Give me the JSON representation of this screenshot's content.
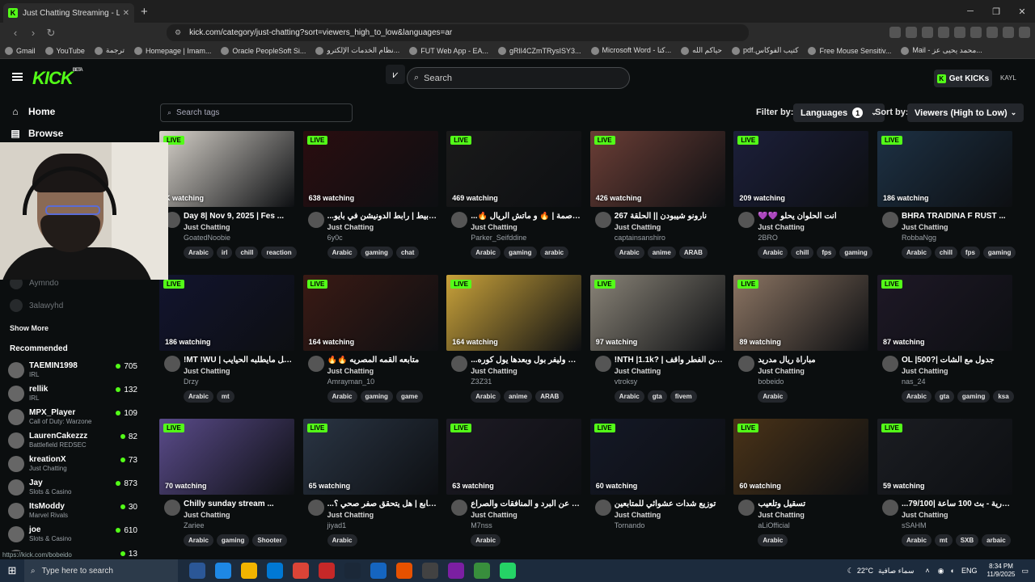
{
  "browser": {
    "tab_title": "Just Chatting Streaming - Live S",
    "tab_close": "✕",
    "new_tab": "+",
    "url": "kick.com/category/just-chatting?sort=viewers_high_to_low&languages=ar",
    "bookmarks": [
      "Gmail",
      "YouTube",
      "ترجمة",
      "Homepage | Imam...",
      "Oracle PeopleSoft Si...",
      "نظام الخدمات الإلكترو...",
      "FUT Web App - EA...",
      "gRlI4CZmTRysISY3...",
      "Microsoft Word - كتا...",
      "حياكم الله",
      "pdf.كتيب الفوكاس",
      "Free Mouse Sensitiv...",
      "Mail - محمد يحيى عز..."
    ]
  },
  "header": {
    "logo": "KICK",
    "beta": "BETA",
    "search_placeholder": "Search",
    "get_kicks": "Get KICKs",
    "user": "KAYL"
  },
  "sidebar": {
    "home": "Home",
    "browse": "Browse",
    "followed": [
      "Aymndo",
      "3alawyhd"
    ],
    "show_more": "Show More",
    "recommended_title": "Recommended",
    "recommended": [
      {
        "name": "TAEMIN1998",
        "cat": "IRL",
        "count": "705"
      },
      {
        "name": "rellik",
        "cat": "IRL",
        "count": "132"
      },
      {
        "name": "MPX_Player",
        "cat": "Call of Duty: Warzone",
        "count": "109"
      },
      {
        "name": "LaurenCakezzz",
        "cat": "Battlefield REDSEC",
        "count": "82"
      },
      {
        "name": "kreationX",
        "cat": "Just Chatting",
        "count": "73"
      },
      {
        "name": "Jay",
        "cat": "Slots & Casino",
        "count": "873"
      },
      {
        "name": "ItsModdy",
        "cat": "Marvel Rivals",
        "count": "30"
      },
      {
        "name": "joe",
        "cat": "Slots & Casino",
        "count": "610"
      },
      {
        "name": "",
        "cat": "",
        "count": "13"
      }
    ],
    "status_url": "https://kick.com/bobeido"
  },
  "filters": {
    "tag_placeholder": "Search tags",
    "filter_by": "Filter by:",
    "languages": "Languages",
    "lang_count": "1",
    "sort_by": "Sort by:",
    "sort_value": "Viewers (High to Low)"
  },
  "streams": [
    {
      "watching": "K watching",
      "title": "Day 8| Nov 9, 2025 | Fes ...",
      "cat": "Just Chatting",
      "user": "GoatedNoobie",
      "tags": [
        "Arabic",
        "irl",
        "chill",
        "reaction"
      ],
      "color": "#d9d4cc"
    },
    {
      "watching": "638 watching",
      "title": "...كم وخرابيط | رابط الدونيشن في بايو",
      "cat": "Just Chatting",
      "user": "6y0c",
      "tags": [
        "Arabic",
        "gaming",
        "chat"
      ],
      "color": "#2a0d10"
    },
    {
      "watching": "469 watching",
      "title": "...🔥 ربي العاصمة | 🔥 و ماتش الريال",
      "cat": "Just Chatting",
      "user": "Parker_Seifddine",
      "tags": [
        "Arabic",
        "gaming",
        "arabic"
      ],
      "color": "#1a1a1a"
    },
    {
      "watching": "426 watching",
      "title": "267 نارونو شيبودن || الحلقة",
      "cat": "Just Chatting",
      "user": "captainsanshiro",
      "tags": [
        "Arabic",
        "anime",
        "ARAB"
      ],
      "color": "#6b3e36"
    },
    {
      "watching": "209 watching",
      "title": "💜💜 انت الحلوان يحلو",
      "cat": "Just Chatting",
      "user": "2BRO",
      "tags": [
        "Arabic",
        "chill",
        "fps",
        "gaming"
      ],
      "color": "#1c1f3a"
    },
    {
      "watching": "186 watching",
      "title": "BHRA TRAIDINA F RUST ...",
      "cat": "Just Chatting",
      "user": "RobbaNgg",
      "tags": [
        "Arabic",
        "chill",
        "fps",
        "gaming"
      ],
      "color": "#1d3144"
    },
    {
      "watching": "186 watching",
      "title": "!MT !WU | وكل مايطلبه الحيايب ...",
      "cat": "Just Chatting",
      "user": "Drzy",
      "tags": [
        "Arabic",
        "mt"
      ],
      "color": "#12142e"
    },
    {
      "watching": "164 watching",
      "title": "🔥🔥 متابعه القمه المصريه",
      "cat": "Just Chatting",
      "user": "Amrayman_10",
      "tags": [
        "Arabic",
        "gaming",
        "game"
      ],
      "color": "#3a1a14"
    },
    {
      "watching": "164 watching",
      "title": "...مبارة الستي وليفر بول وبعدها يول كوره",
      "cat": "Just Chatting",
      "user": "Z3Z31",
      "tags": [
        "Arabic",
        "anime",
        "ARAB"
      ],
      "color": "#c9a23a"
    },
    {
      "watching": "97 watching",
      "title": "!NTH |1.1k? | ديد عن الفطر واقف",
      "cat": "Just Chatting",
      "user": "vtroksy",
      "tags": [
        "Arabic",
        "gta",
        "fivem"
      ],
      "color": "#8a8478"
    },
    {
      "watching": "89 watching",
      "title": "مباراة ريال مدريد",
      "cat": "Just Chatting",
      "user": "bobeido",
      "tags": [
        "Arabic"
      ],
      "color": "#8c7563"
    },
    {
      "watching": "87 watching",
      "title": "OL |500?| جدول مع الشات",
      "cat": "Just Chatting",
      "user": "nas_24",
      "tags": [
        "Arabic",
        "gta",
        "gaming",
        "ksa"
      ],
      "color": "#1e1826"
    },
    {
      "watching": "70 watching",
      "title": "Chilly sunday stream ...",
      "cat": "Just Chatting",
      "user": "Zariee",
      "tags": [
        "Arabic",
        "gaming",
        "Shooter"
      ],
      "color": "#5a4b8a"
    },
    {
      "watching": "65 watching",
      "title": "...ة مع متابع | هل يتحقق صفر صحي ؟",
      "cat": "Just Chatting",
      "user": "jiyad1",
      "tags": [
        "Arabic"
      ],
      "color": "#2a3544"
    },
    {
      "watching": "63 watching",
      "title": "يتسولف عن البرد و المنافقات والصراع",
      "cat": "Just Chatting",
      "user": "M7nss",
      "tags": [
        "Arabic"
      ],
      "color": "#1d1a24"
    },
    {
      "watching": "60 watching",
      "title": "توزيع شدات عشوائي للمتابعين",
      "cat": "Just Chatting",
      "user": "Tornando",
      "tags": [],
      "color": "#141826"
    },
    {
      "watching": "60 watching",
      "title": "تسقيل وتلعيب",
      "cat": "Just Chatting",
      "user": "aLiOfficial",
      "tags": [
        "Arabic"
      ],
      "color": "#4a3318"
    },
    {
      "watching": "59 watching",
      "title": "...تمرارية - بث 100 ساعة |79/100",
      "cat": "Just Chatting",
      "user": "sSAHM",
      "tags": [
        "Arabic",
        "mt",
        "SXB",
        "arbaic"
      ],
      "color": "#1b1d22"
    }
  ],
  "taskbar": {
    "search": "Type here to search",
    "weather": "22°C",
    "weather_text": "سماء صافية",
    "lang": "ENG",
    "time": "8:34 PM",
    "date": "11/9/2025"
  }
}
